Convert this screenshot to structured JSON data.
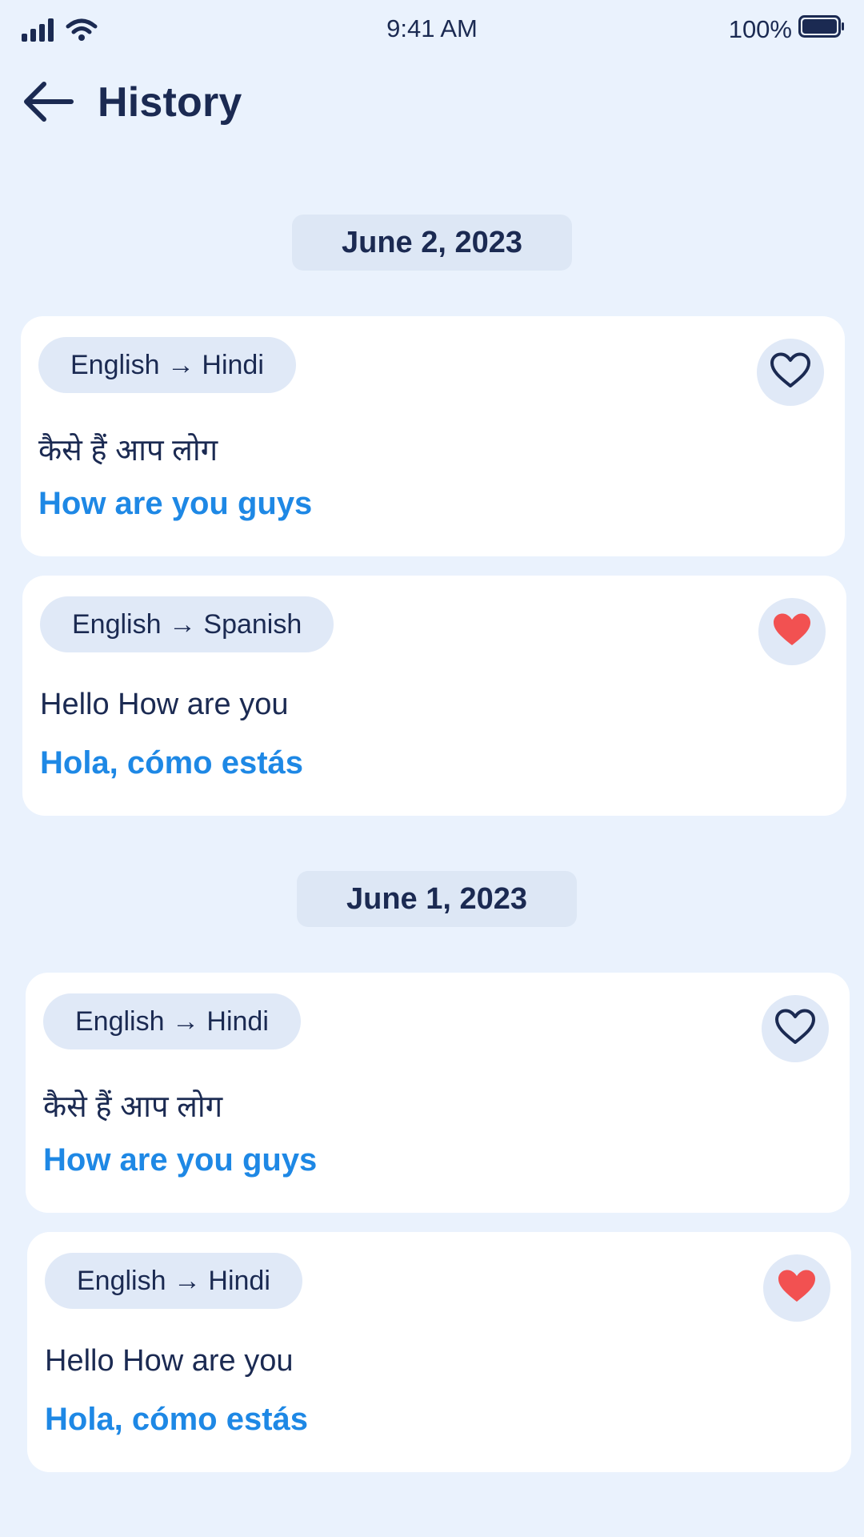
{
  "status_bar": {
    "time": "9:41 AM",
    "battery": "100%"
  },
  "header": {
    "title": "History"
  },
  "colors": {
    "background": "#eaf2fd",
    "accent": "#1e88e5",
    "text": "#1b2a52",
    "favorite": "#f25151",
    "chip": "#dde7f5"
  },
  "groups": [
    {
      "date": "June 2,  2023",
      "items": [
        {
          "languages": "English → Hindi",
          "source": "कैसे हैं आप लोग",
          "translation": "How are you guys",
          "favorite": false
        },
        {
          "languages": "English →  Spanish",
          "source": "Hello How are you",
          "translation": "Hola, cómo estás",
          "favorite": true
        }
      ]
    },
    {
      "date": "June 1,  2023",
      "items": [
        {
          "languages": "English → Hindi",
          "source": "कैसे हैं आप लोग",
          "translation": "How are you guys",
          "favorite": false
        },
        {
          "languages": "English → Hindi",
          "source": "Hello How are you",
          "translation": "Hola, cómo estás",
          "favorite": true
        }
      ]
    }
  ]
}
